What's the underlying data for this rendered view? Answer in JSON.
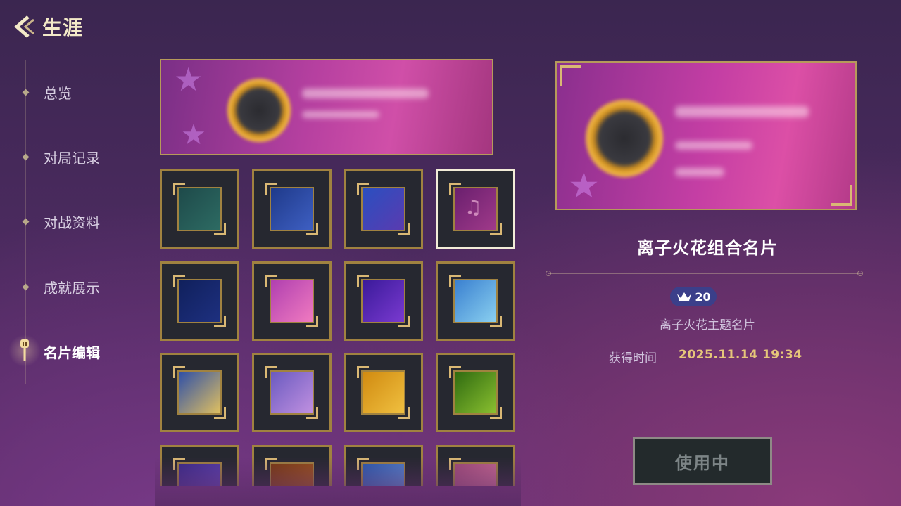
{
  "header": {
    "title": "生涯"
  },
  "sidebar": {
    "items": [
      {
        "label": "总览"
      },
      {
        "label": "对局记录"
      },
      {
        "label": "对战资料"
      },
      {
        "label": "成就展示"
      },
      {
        "label": "名片编辑",
        "active": true
      }
    ]
  },
  "grid": {
    "tiles": [
      {
        "icon": "teal-frame",
        "colors": [
          "#1e4a4a",
          "#2d6b63"
        ]
      },
      {
        "icon": "blue-crystal-frame",
        "colors": [
          "#1f3a8a",
          "#3e5fc2"
        ]
      },
      {
        "icon": "cosmic-swirl-frame",
        "colors": [
          "#2a4fc0",
          "#5a3bb0"
        ]
      },
      {
        "icon": "music-note-frame",
        "colors": [
          "#6a1f6e",
          "#a03a8a"
        ],
        "selected": true
      },
      {
        "icon": "navy-frame",
        "colors": [
          "#10205c",
          "#1e3080"
        ]
      },
      {
        "icon": "pink-creature-frame",
        "colors": [
          "#b040b0",
          "#f07ac0"
        ]
      },
      {
        "icon": "galaxy-star-frame",
        "colors": [
          "#3a1a9a",
          "#7a3ad0"
        ]
      },
      {
        "icon": "ice-cream-frame",
        "colors": [
          "#3a80d0",
          "#8ad0f0"
        ]
      },
      {
        "icon": "moon-map-frame",
        "colors": [
          "#2e4fa8",
          "#e0c060"
        ]
      },
      {
        "icon": "lavender-swirl-frame",
        "colors": [
          "#6a5ac0",
          "#c090e0"
        ]
      },
      {
        "icon": "golden-5-frame",
        "colors": [
          "#d08a10",
          "#f0c040"
        ]
      },
      {
        "icon": "green-leaf-frame",
        "colors": [
          "#2f6a10",
          "#8ac030"
        ]
      },
      {
        "icon": "purple-gear-frame",
        "colors": [
          "#3a2a8a",
          "#6a4ac0"
        ]
      },
      {
        "icon": "amber-frame",
        "colors": [
          "#7a3a10",
          "#b06020"
        ]
      },
      {
        "icon": "blue-critter-frame",
        "colors": [
          "#2a5ab0",
          "#6a9ae0"
        ]
      },
      {
        "icon": "rose-critter-frame",
        "colors": [
          "#a04a7a",
          "#e07aa0"
        ]
      }
    ]
  },
  "detail": {
    "name": "离子火花组合名片",
    "badge_value": "20",
    "subtitle": "离子火花主题名片",
    "acquired_label": "获得时间",
    "acquired_value": "2025.11.14  19:34",
    "use_button": "使用中"
  },
  "colors": {
    "accent_gold": "#e6c67a",
    "frame_gold": "#a08240",
    "badge_bg": "#3b3f8a"
  }
}
